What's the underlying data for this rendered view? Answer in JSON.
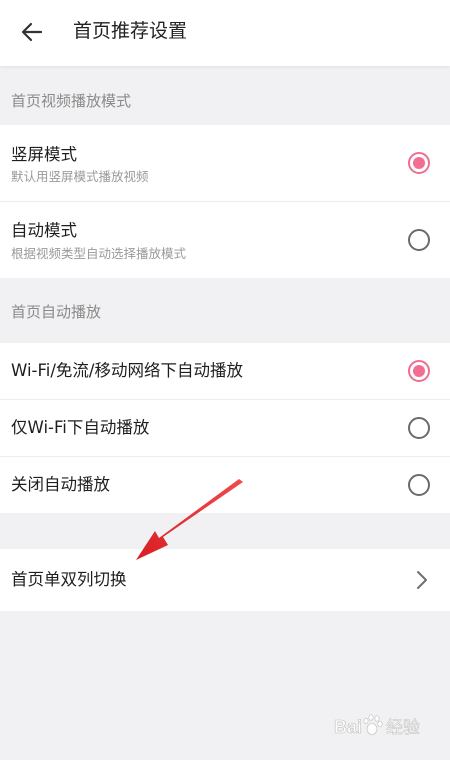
{
  "header": {
    "title": "首页推荐设置",
    "back_icon": "arrow-left-icon"
  },
  "sections": [
    {
      "title": "首页视频播放模式",
      "options": [
        {
          "label": "竖屏模式",
          "sublabel": "默认用竖屏模式播放视频",
          "selected": true
        },
        {
          "label": "自动模式",
          "sublabel": "根据视频类型自动选择播放模式",
          "selected": false
        }
      ]
    },
    {
      "title": "首页自动播放",
      "options": [
        {
          "label": "Wi-Fi/免流/移动网络下自动播放",
          "selected": true
        },
        {
          "label": "仅Wi-Fi下自动播放",
          "selected": false
        },
        {
          "label": "关闭自动播放",
          "selected": false
        }
      ]
    }
  ],
  "layout_toggle": {
    "label": "首页单双列切换",
    "icon": "chevron-right-icon"
  },
  "annotation": {
    "icon": "red-pointer-arrow-icon",
    "color": "#e3262b"
  },
  "watermark": {
    "text": "Bai百经验",
    "icon": "baidu-paw-icon"
  },
  "colors": {
    "accent": "#f06e92",
    "background": "#f1f1f3",
    "section_text": "#8a8a8a"
  }
}
